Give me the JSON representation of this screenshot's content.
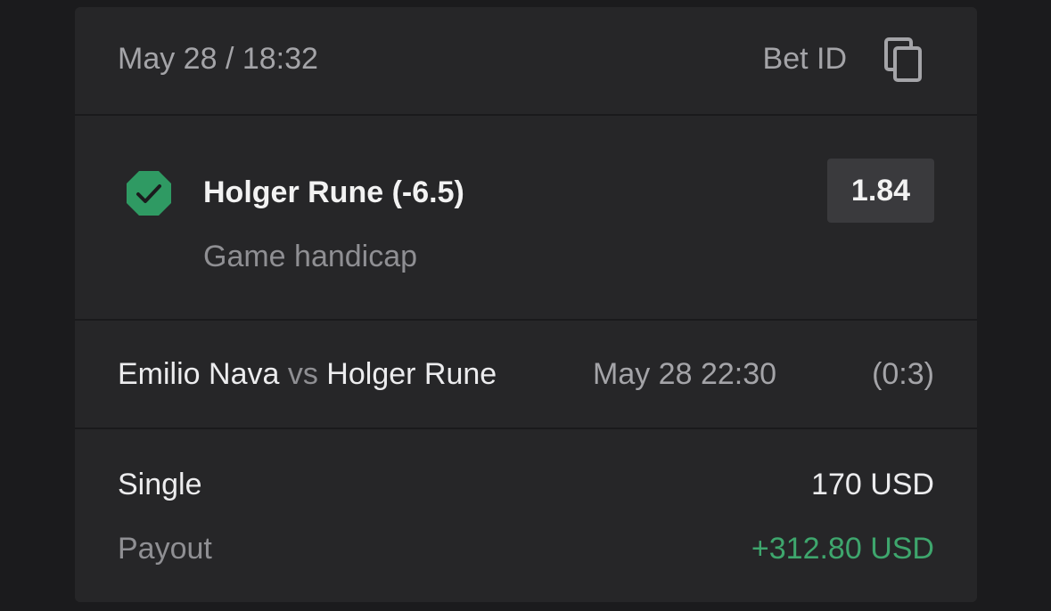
{
  "header": {
    "datetime": "May 28 / 18:32",
    "bet_id_label": "Bet ID",
    "copy_icon": "copy-icon"
  },
  "selection": {
    "status_icon": "check-circle-icon",
    "status_color": "#2f9a63",
    "title": "Holger Rune (-6.5)",
    "market": "Game handicap",
    "odds": "1.84"
  },
  "event": {
    "team_home": "Emilio Nava",
    "vs": "vs",
    "team_away": "Holger Rune",
    "start_time": "May 28 22:30",
    "score": "(0:3)"
  },
  "summary": {
    "bet_type": "Single",
    "stake": "170 USD",
    "payout_label": "Payout",
    "payout_value": "+312.80 USD",
    "payout_color": "#3ea66d"
  }
}
